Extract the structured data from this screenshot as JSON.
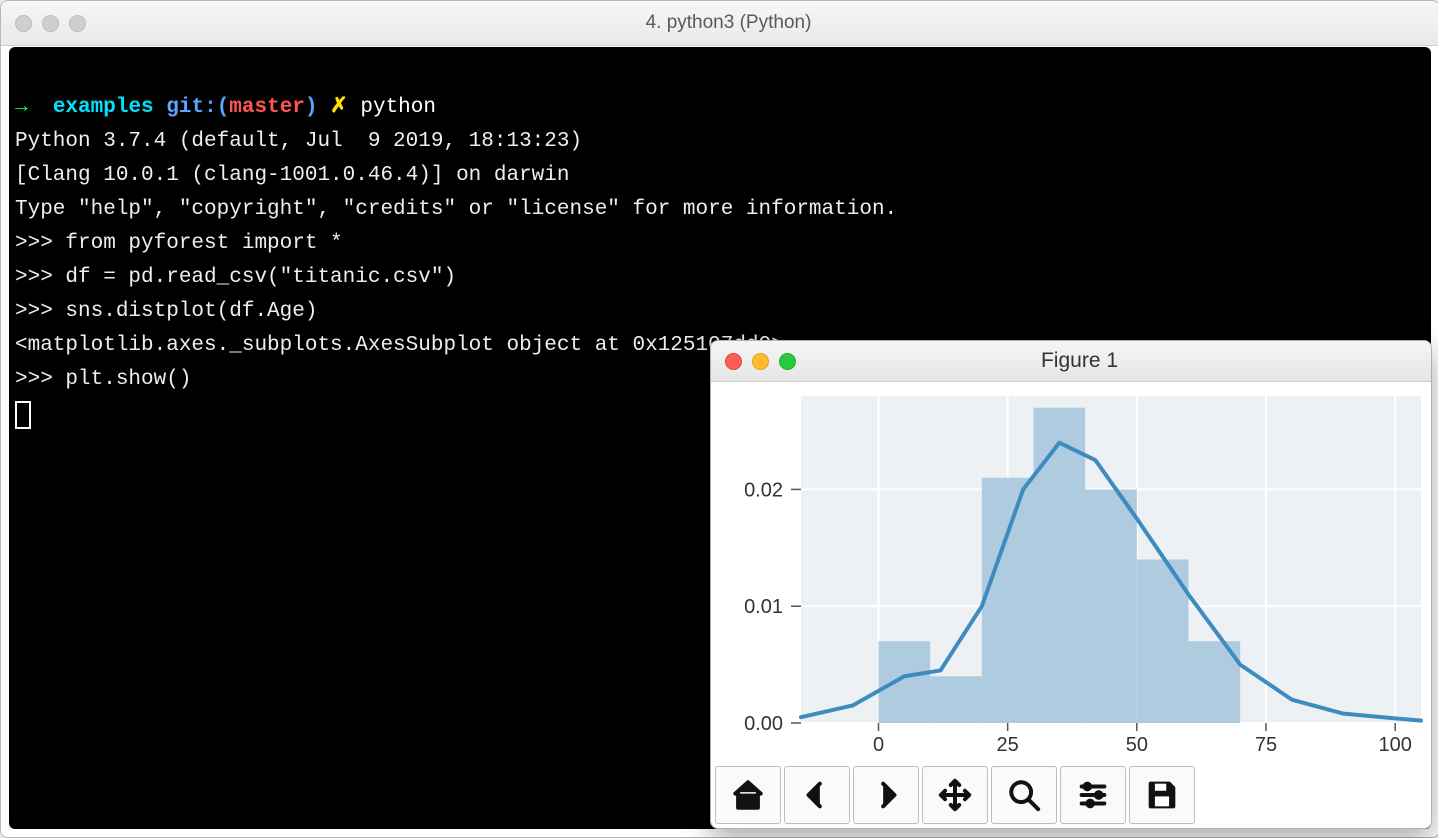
{
  "term": {
    "title": "4. python3 (Python)",
    "prompt": {
      "arrow": "→",
      "cwd": "examples",
      "git": "git:",
      "branch": "master",
      "dirty": "✗",
      "cmd": "python"
    },
    "lines": {
      "l0": "Python 3.7.4 (default, Jul  9 2019, 18:13:23)",
      "l1": "[Clang 10.0.1 (clang-1001.0.46.4)] on darwin",
      "l2": "Type \"help\", \"copyright\", \"credits\" or \"license\" for more information.",
      "l3": ">>> from pyforest import *",
      "l4": ">>> df = pd.read_csv(\"titanic.csv\")",
      "l5": ">>> sns.distplot(df.Age)",
      "l6": "<matplotlib.axes._subplots.AxesSubplot object at 0x125107dd0>",
      "l7": ">>> plt.show()"
    }
  },
  "figure": {
    "title": "Figure 1",
    "toolbar": [
      "home",
      "back",
      "forward",
      "pan",
      "zoom",
      "configure",
      "save"
    ]
  },
  "chart_data": {
    "type": "histogram_kde",
    "xlabel": "",
    "ylabel": "",
    "x_ticks": [
      0,
      25,
      50,
      75,
      100
    ],
    "y_ticks": [
      0.0,
      0.01,
      0.02
    ],
    "y_tick_labels": [
      "0.00",
      "0.01",
      "0.02"
    ],
    "xlim": [
      -15,
      105
    ],
    "ylim": [
      0,
      0.028
    ],
    "bar_color": "#aecbe0",
    "line_color": "#3e8bbf",
    "bins": [
      {
        "x0": -10,
        "x1": 0,
        "y": 0.0
      },
      {
        "x0": 0,
        "x1": 10,
        "y": 0.007
      },
      {
        "x0": 10,
        "x1": 20,
        "y": 0.004
      },
      {
        "x0": 20,
        "x1": 30,
        "y": 0.021
      },
      {
        "x0": 30,
        "x1": 40,
        "y": 0.027
      },
      {
        "x0": 40,
        "x1": 50,
        "y": 0.02
      },
      {
        "x0": 50,
        "x1": 60,
        "y": 0.014
      },
      {
        "x0": 60,
        "x1": 70,
        "y": 0.007
      },
      {
        "x0": 70,
        "x1": 80,
        "y": 0.0
      },
      {
        "x0": 80,
        "x1": 90,
        "y": 0.0
      }
    ],
    "kde": [
      {
        "x": -15,
        "y": 0.0005
      },
      {
        "x": -5,
        "y": 0.0015
      },
      {
        "x": 5,
        "y": 0.004
      },
      {
        "x": 12,
        "y": 0.0045
      },
      {
        "x": 20,
        "y": 0.01
      },
      {
        "x": 28,
        "y": 0.02
      },
      {
        "x": 35,
        "y": 0.024
      },
      {
        "x": 42,
        "y": 0.0225
      },
      {
        "x": 50,
        "y": 0.0175
      },
      {
        "x": 60,
        "y": 0.011
      },
      {
        "x": 70,
        "y": 0.005
      },
      {
        "x": 80,
        "y": 0.002
      },
      {
        "x": 90,
        "y": 0.0008
      },
      {
        "x": 105,
        "y": 0.0002
      }
    ]
  }
}
